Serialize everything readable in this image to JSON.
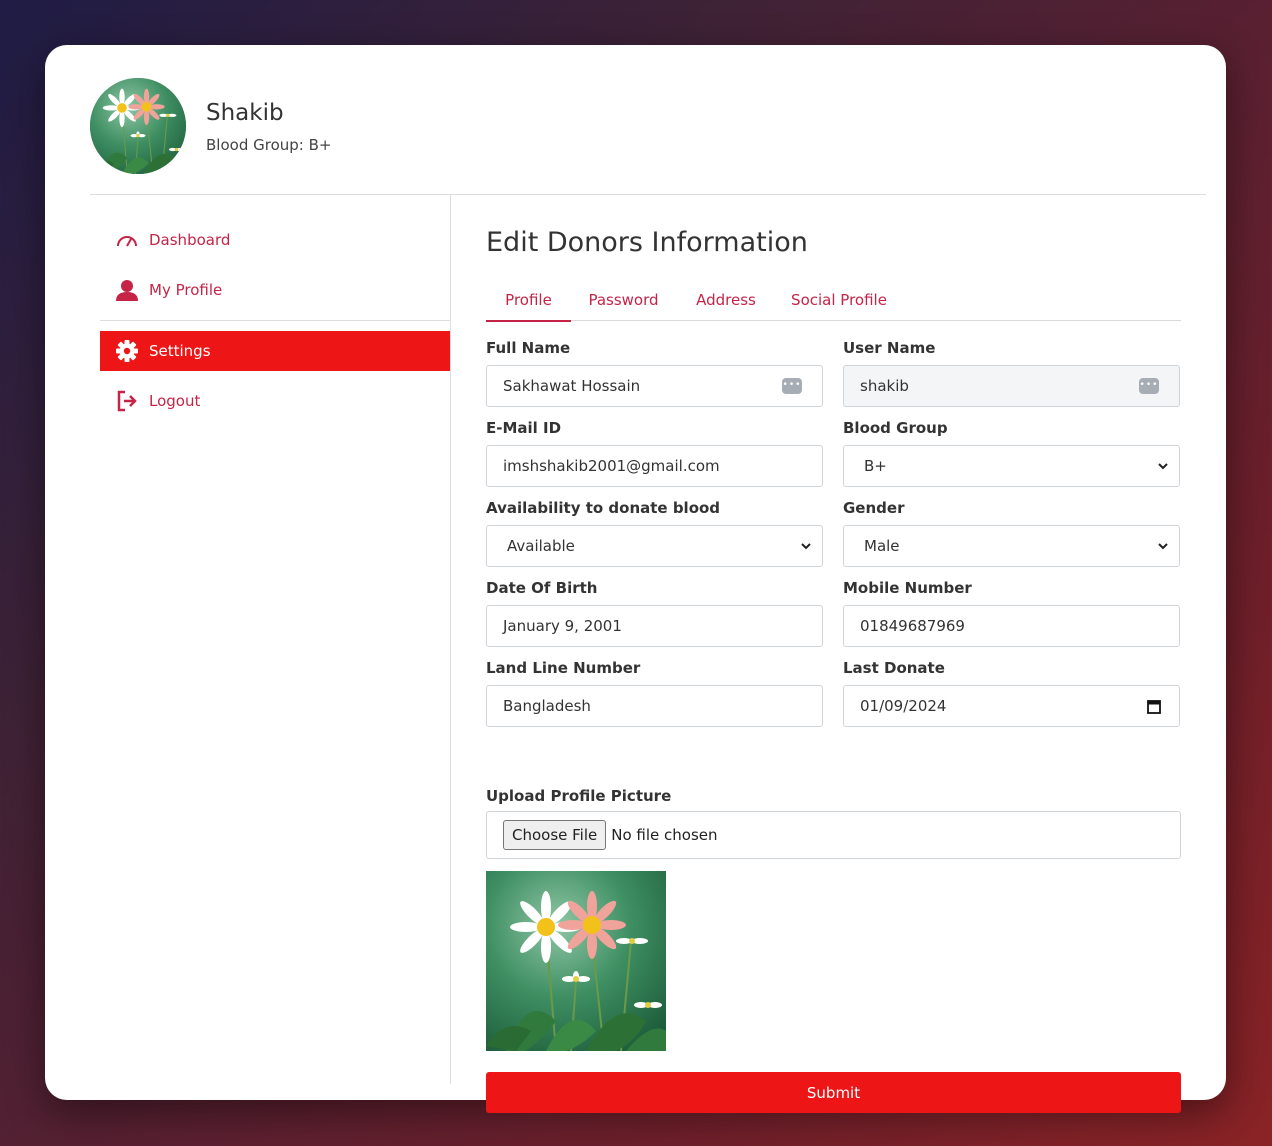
{
  "profile": {
    "name": "Shakib",
    "blood_group_text": "Blood Group: B+"
  },
  "sidebar": {
    "items": [
      {
        "label": "Dashboard",
        "icon": "dashboard-gauge-icon"
      },
      {
        "label": "My Profile",
        "icon": "user-icon"
      },
      {
        "label": "Settings",
        "icon": "gear-icon",
        "active": true
      },
      {
        "label": "Logout",
        "icon": "logout-icon"
      }
    ]
  },
  "main": {
    "title": "Edit Donors Information",
    "tabs": [
      {
        "label": "Profile",
        "active": true
      },
      {
        "label": "Password"
      },
      {
        "label": "Address"
      },
      {
        "label": "Social Profile"
      }
    ]
  },
  "form": {
    "full_name": {
      "label": "Full Name",
      "value": "Sakhawat Hossain"
    },
    "user_name": {
      "label": "User Name",
      "value": "shakib"
    },
    "email": {
      "label": "E-Mail ID",
      "value": "imshshakib2001@gmail.com"
    },
    "blood_group": {
      "label": "Blood Group",
      "value": "B+"
    },
    "availability": {
      "label": "Availability to donate blood",
      "value": "Available"
    },
    "gender": {
      "label": "Gender",
      "value": "Male"
    },
    "dob": {
      "label": "Date Of Birth",
      "value": "January 9, 2001"
    },
    "mobile": {
      "label": "Mobile Number",
      "value": "01849687969"
    },
    "landline": {
      "label": "Land Line Number",
      "value": "Bangladesh"
    },
    "last_donate": {
      "label": "Last Donate",
      "value": "01/09/2024"
    },
    "upload": {
      "label": "Upload Profile Picture",
      "button": "Choose File",
      "status": "No file chosen"
    },
    "submit_label": "Submit"
  },
  "colors": {
    "accent": "#c52447",
    "primary_red": "#ed1515"
  }
}
